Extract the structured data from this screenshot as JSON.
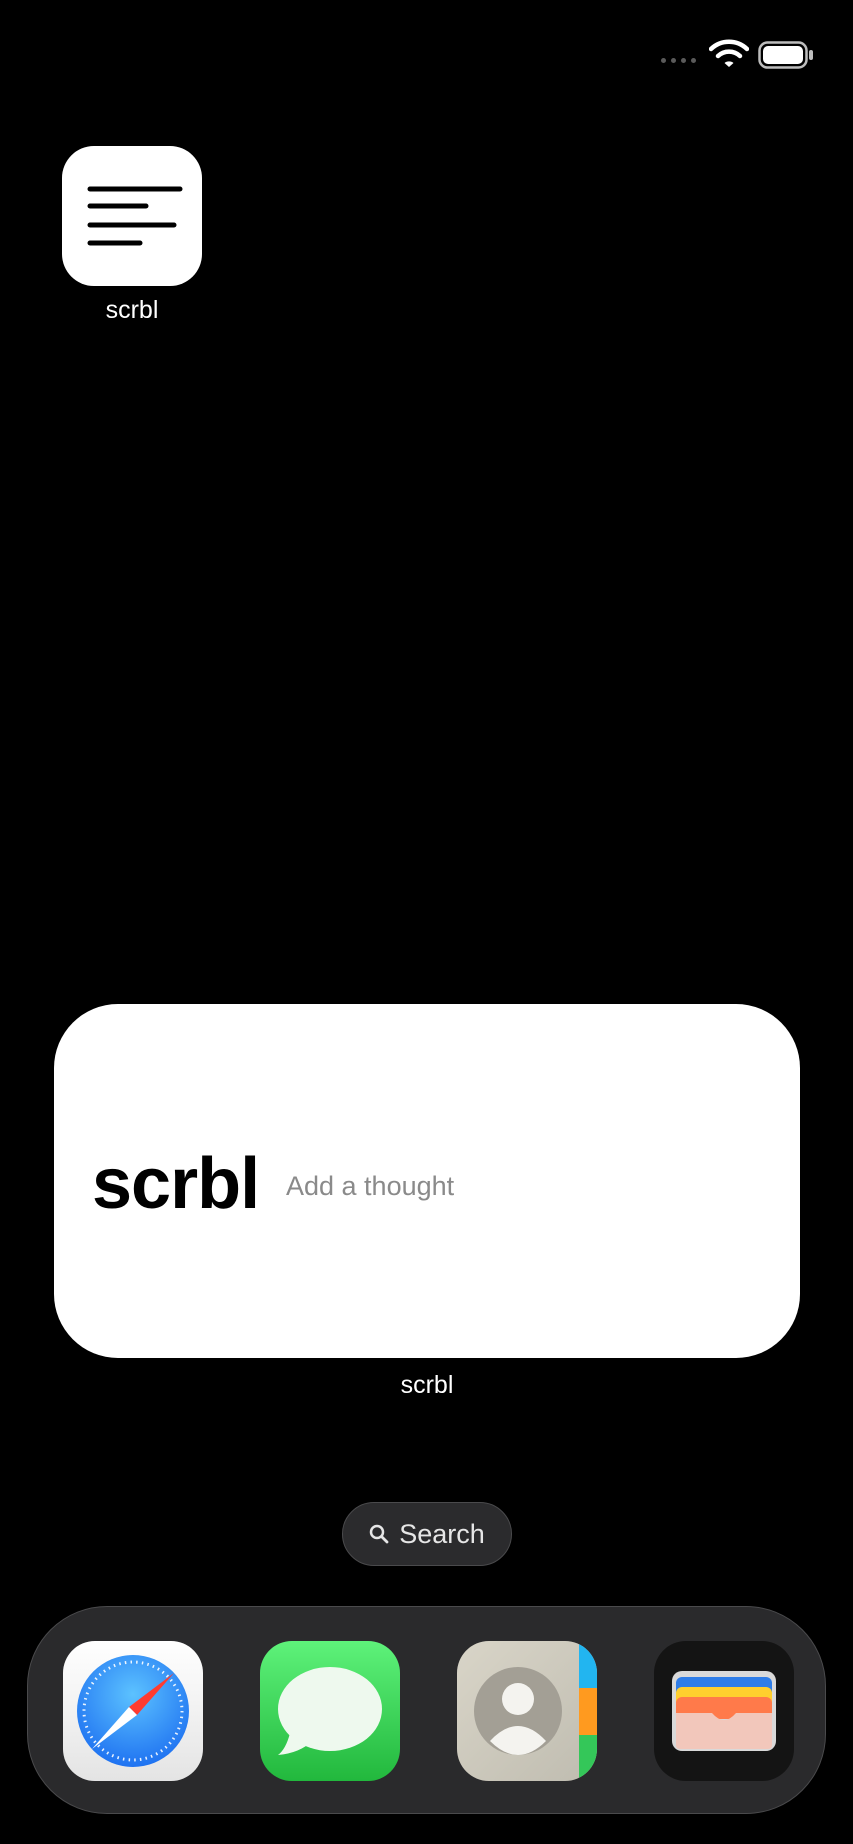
{
  "status_bar": {
    "signal_icon": "cellular-signal-icon",
    "wifi_icon": "wifi-icon",
    "battery_icon": "battery-icon",
    "battery_level": 1.0
  },
  "home_screen": {
    "app": {
      "label": "scrbl",
      "icon": "notes-lines-icon"
    },
    "widget": {
      "title": "scrbl",
      "input_placeholder": "Add a thought",
      "input_value": "",
      "label": "scrbl"
    },
    "search": {
      "label": "Search",
      "icon": "magnifier-icon"
    }
  },
  "dock": {
    "apps": [
      {
        "name": "Safari",
        "icon": "compass-icon"
      },
      {
        "name": "Messages",
        "icon": "speech-bubble-icon"
      },
      {
        "name": "Contacts",
        "icon": "person-icon"
      },
      {
        "name": "Wallet",
        "icon": "wallet-cards-icon"
      }
    ]
  },
  "colors": {
    "background": "#000000",
    "widget": "#ffffff",
    "messages_green": "#34c759",
    "safari_blue": "#1e88f5"
  }
}
